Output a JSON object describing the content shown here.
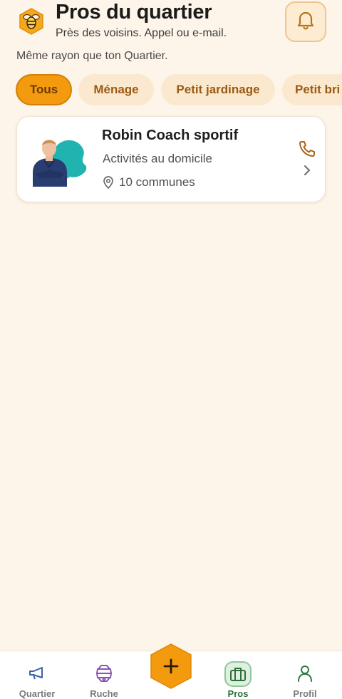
{
  "header": {
    "title": "Pros du quartier",
    "subtitle": "Près des voisins. Appel ou e-mail.",
    "logo_icon": "bee-hexagon-icon",
    "bell_icon": "bell-icon"
  },
  "radius_note": "Même rayon que ton Quartier.",
  "filters": {
    "chips": [
      {
        "label": "Tous",
        "active": true
      },
      {
        "label": "Ménage",
        "active": false
      },
      {
        "label": "Petit jardinage",
        "active": false
      },
      {
        "label": "Petit bri",
        "active": false
      }
    ]
  },
  "pros": [
    {
      "name": "Robin Coach sportif",
      "category": "Activités au domicile",
      "zone": "10 communes",
      "phone_icon": "phone-icon",
      "pin_icon": "map-pin-icon"
    }
  ],
  "tabbar": {
    "tabs": [
      {
        "label": "Quartier",
        "icon": "megaphone-icon",
        "active": false
      },
      {
        "label": "Ruche",
        "icon": "beehive-icon",
        "active": false
      },
      {
        "label": "Pros",
        "icon": "briefcase-icon",
        "active": true
      },
      {
        "label": "Profil",
        "icon": "user-icon",
        "active": false
      }
    ],
    "fab_icon": "plus-icon"
  },
  "colors": {
    "background": "#fdf5ea",
    "accent": "#f39a0f",
    "chip_bg": "#fbe9cf",
    "chip_text": "#9a5a12",
    "active_tab": "#2f6f3a"
  }
}
